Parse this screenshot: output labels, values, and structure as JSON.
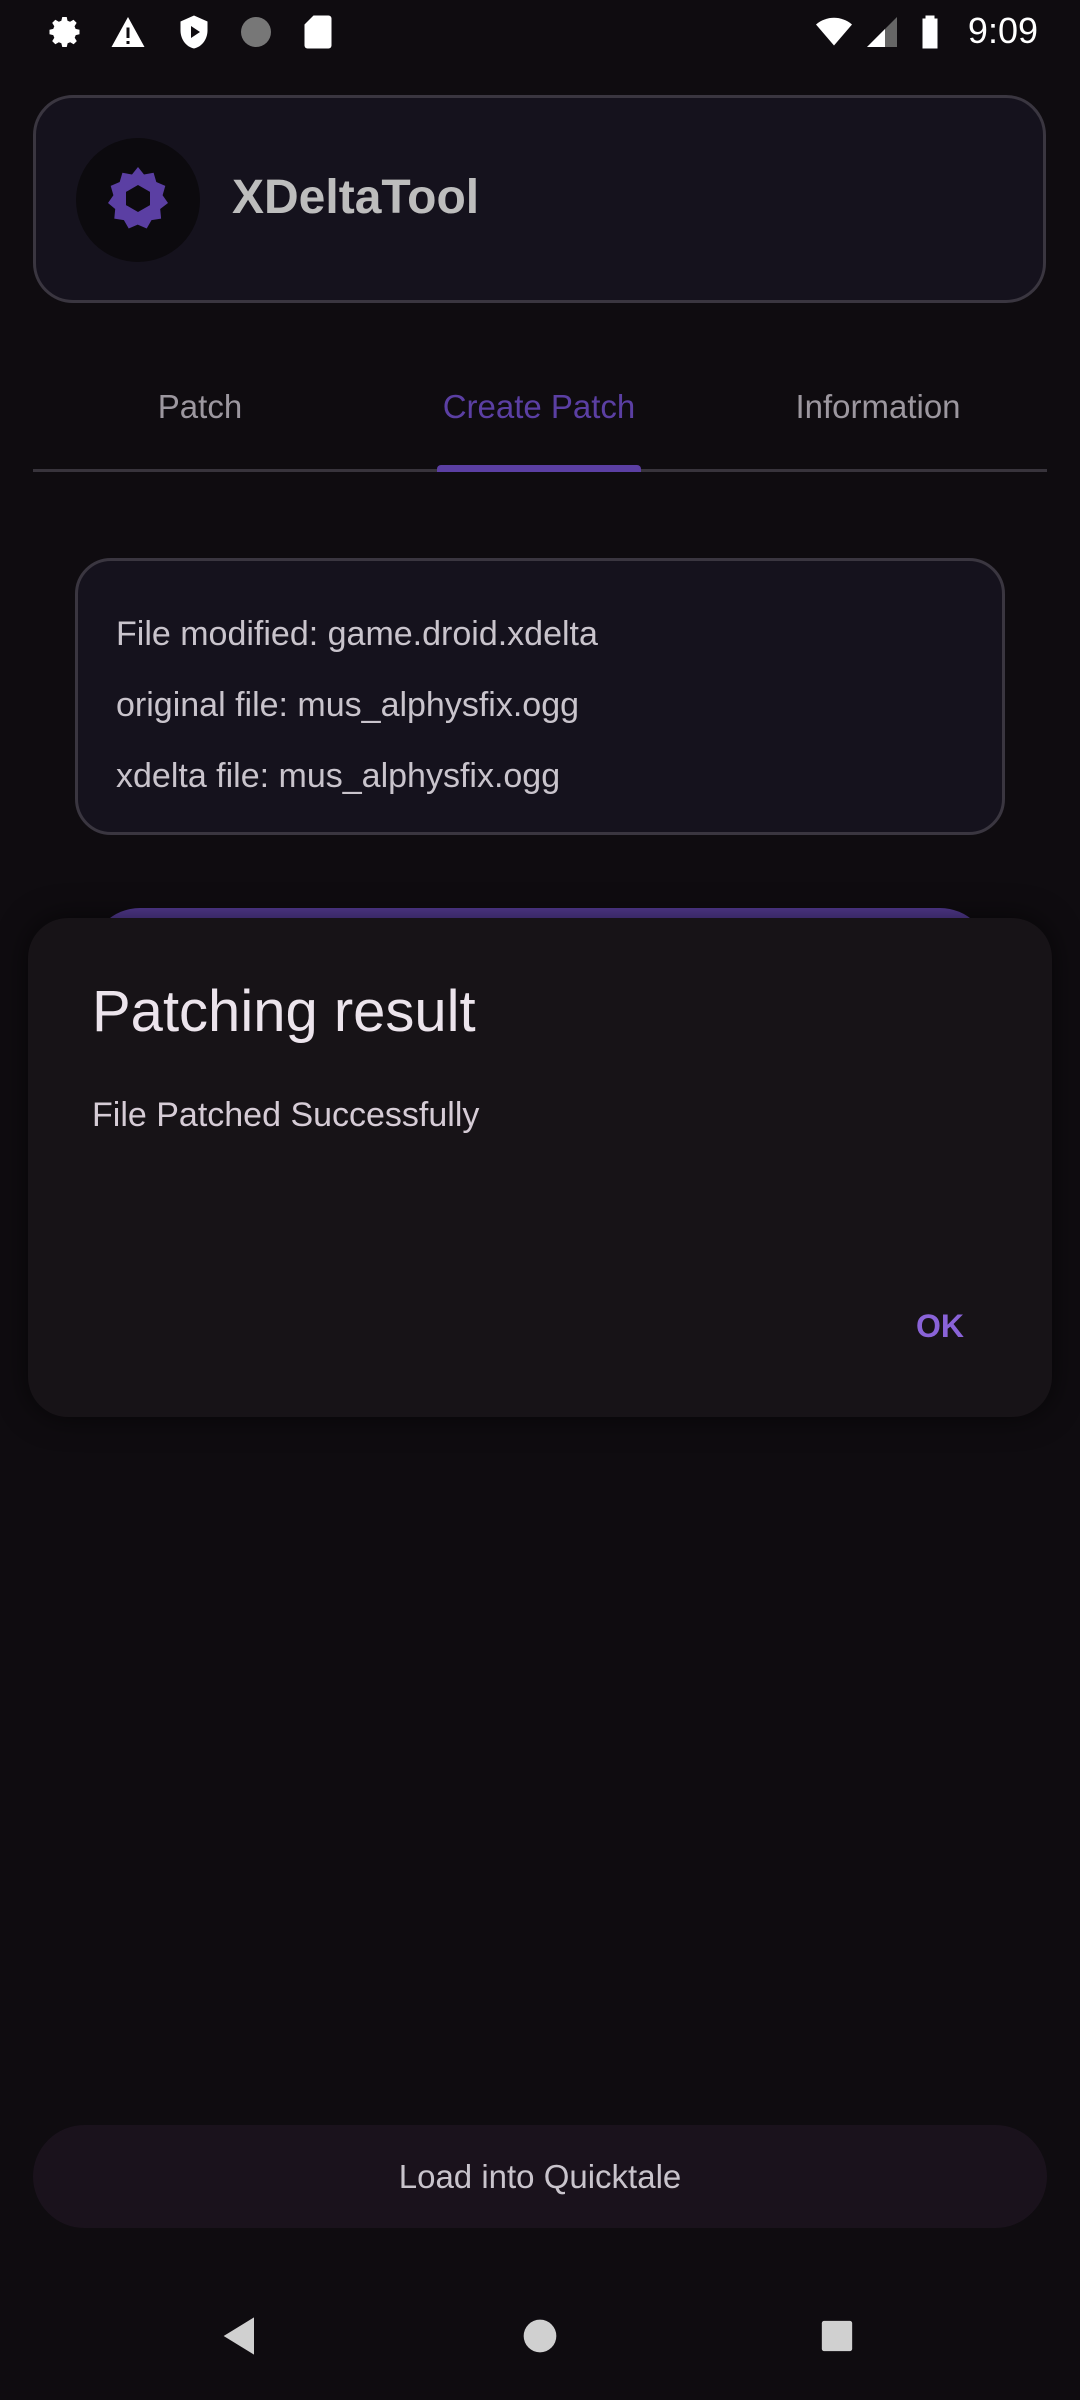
{
  "status_bar": {
    "time": "9:09",
    "left_icons": [
      "gear-icon",
      "warning-icon",
      "shield-play-icon",
      "loading-circle-icon",
      "sd-card-icon"
    ],
    "right_icons": [
      "wifi-icon",
      "signal-icon",
      "battery-icon"
    ]
  },
  "header": {
    "app_title": "XDeltaTool",
    "logo_icon": "gear-icon"
  },
  "tabs": [
    {
      "label": "Patch",
      "selected": false
    },
    {
      "label": "Create Patch",
      "selected": true
    },
    {
      "label": "Information",
      "selected": false
    }
  ],
  "info_card": {
    "lines": [
      "File modified: game.droid.xdelta",
      "original file: mus_alphysfix.ogg",
      "xdelta file: mus_alphysfix.ogg"
    ]
  },
  "dialog": {
    "title": "Patching result",
    "message": "File Patched Successfully",
    "ok_label": "OK"
  },
  "bottom_button": {
    "label": "Load into Quicktale"
  },
  "colors": {
    "accent": "#5b3fa3",
    "ok": "#8a63d8",
    "background": "#0f0c10"
  }
}
